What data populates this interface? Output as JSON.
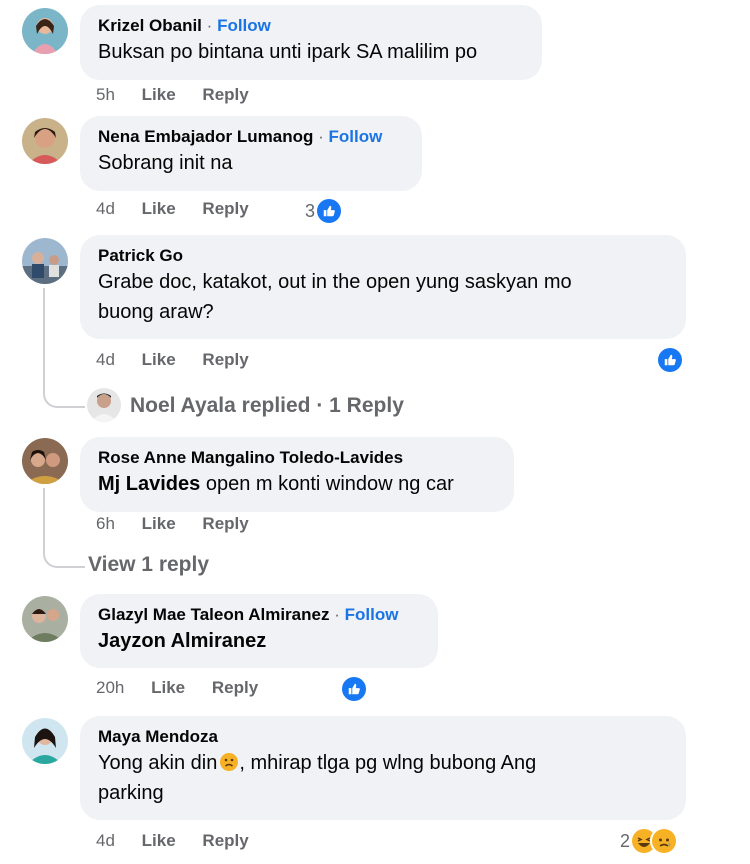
{
  "comments": [
    {
      "author": "Krizel Obanil",
      "follow": "Follow",
      "text": "Buksan po bintana unti ipark SA malilim po",
      "time": "5h",
      "like": "Like",
      "reply": "Reply"
    },
    {
      "author": "Nena Embajador Lumanog",
      "follow": "Follow",
      "text": "Sobrang init na",
      "time": "4d",
      "like": "Like",
      "reply": "Reply",
      "reaction_count": "3"
    },
    {
      "author": "Patrick Go",
      "text_line1": "Grabe doc, katakot, out in the open yung saskyan mo",
      "text_line2": "buong araw?",
      "time": "4d",
      "like": "Like",
      "reply": "Reply",
      "replied_text": "Noel Ayala replied · 1 Reply"
    },
    {
      "author": "Rose Anne Mangalino Toledo-Lavides",
      "mention": "Mj Lavides",
      "text": " open m konti window ng car",
      "time": "6h",
      "like": "Like",
      "reply": "Reply",
      "view_replies": "View 1 reply"
    },
    {
      "author": "Glazyl Mae Taleon Almiranez",
      "follow": "Follow",
      "mention": "Jayzon Almiranez",
      "time": "20h",
      "like": "Like",
      "reply": "Reply"
    },
    {
      "author": "Maya Mendoza",
      "text_part1": "Yong akin din",
      "text_part2": ", mhirap tlga pg wlng bubong Ang",
      "text_line2": "parking",
      "time": "4d",
      "like": "Like",
      "reply": "Reply",
      "reaction_count": "2"
    }
  ],
  "separator": "·",
  "colors": {
    "bubble": "#f0f2f5",
    "link": "#1b74e4",
    "meta": "#65676b",
    "like": "#1877f2"
  }
}
